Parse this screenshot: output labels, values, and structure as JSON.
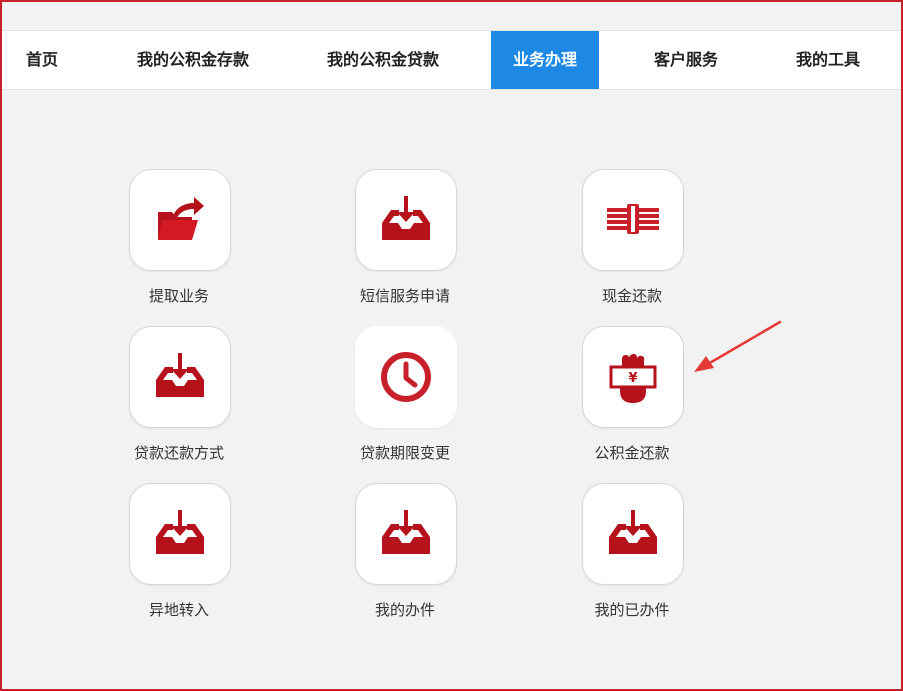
{
  "nav": {
    "items": [
      {
        "label": "首页",
        "active": false
      },
      {
        "label": "我的公积金存款",
        "active": false
      },
      {
        "label": "我的公积金贷款",
        "active": false
      },
      {
        "label": "业务办理",
        "active": true
      },
      {
        "label": "客户服务",
        "active": false
      },
      {
        "label": "我的工具",
        "active": false
      }
    ]
  },
  "tiles": [
    {
      "label": "提取业务",
      "icon": "folder-export-icon"
    },
    {
      "label": "短信服务申请",
      "icon": "inbox-download-icon"
    },
    {
      "label": "现金还款",
      "icon": "money-stack-icon"
    },
    {
      "label": "贷款还款方式",
      "icon": "inbox-download-icon"
    },
    {
      "label": "贷款期限变更",
      "icon": "clock-icon"
    },
    {
      "label": "公积金还款",
      "icon": "hand-yuan-icon"
    },
    {
      "label": "异地转入",
      "icon": "inbox-download-icon"
    },
    {
      "label": "我的办件",
      "icon": "inbox-download-icon"
    },
    {
      "label": "我的已办件",
      "icon": "inbox-download-icon"
    }
  ],
  "colors": {
    "accent": "#1e88e5",
    "icon_red": "#b5121b",
    "frame_border": "#c8202b",
    "annotation_arrow": "#e53935"
  }
}
